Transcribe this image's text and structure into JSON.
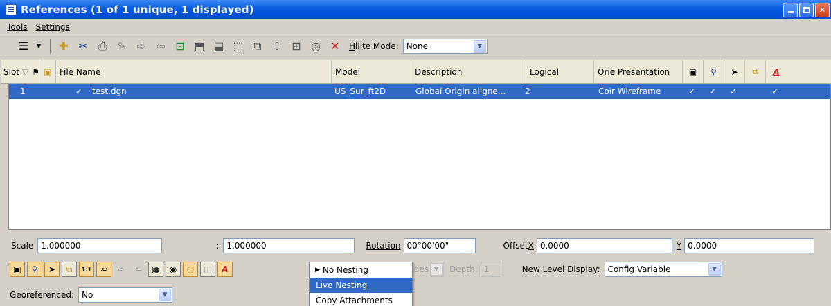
{
  "window": {
    "title": "References (1 of 1 unique, 1 displayed)"
  },
  "menu": {
    "tools": "Tools",
    "settings": "Settings"
  },
  "toolbar": {
    "hilite_label_prefix": "H",
    "hilite_label_rest": "ilite Mode:",
    "hilite_value": "None",
    "icons": [
      "list-tree-icon",
      "attach-icon",
      "detach-icon",
      "reload-icon",
      "clip-boundary-icon",
      "clip-mask-icon",
      "clip-delete-icon",
      "mirror-icon",
      "rotate-icon",
      "scale-icon",
      "move-icon",
      "copy-icon",
      "merge-icon",
      "exchange-icon",
      "snap-icon",
      "delete-icon"
    ]
  },
  "table": {
    "columns": {
      "slot": "Slot",
      "file_name": "File Name",
      "model": "Model",
      "description": "Description",
      "logical": "Logical",
      "orie_presentation": "Orie Presentation"
    },
    "rows": [
      {
        "slot": "1",
        "check": "✓",
        "file_name": "test.dgn",
        "model": "US_Sur_ft2D",
        "description": "Global Origin aligne...",
        "logical": "2",
        "presentation": "Coir Wireframe",
        "flags": [
          "✓",
          "✓",
          "✓",
          "",
          "✓"
        ]
      }
    ]
  },
  "props": {
    "scale_label": "Scale",
    "scale_value_1": "1.000000",
    "colon": ":",
    "scale_value_2": "1.000000",
    "rotation_label": "Rotation",
    "rotation_value": "00°00'00\"",
    "offset_label": "Offset",
    "offset_x_label": "X",
    "offset_x_value": "0.0000",
    "offset_y_label": "Y",
    "offset_y_value": "0.0000"
  },
  "display": {
    "allow_overrides": "Allow Overrides",
    "depth_label": "Depth:",
    "depth_value": "1",
    "new_level_label": "New Level Display:",
    "new_level_value": "Config Variable"
  },
  "geo": {
    "label": "Georeferenced:",
    "value": "No"
  },
  "nesting_menu": {
    "items": [
      "No Nesting",
      "Live Nesting",
      "Copy Attachments"
    ],
    "selected": "Live Nesting"
  }
}
